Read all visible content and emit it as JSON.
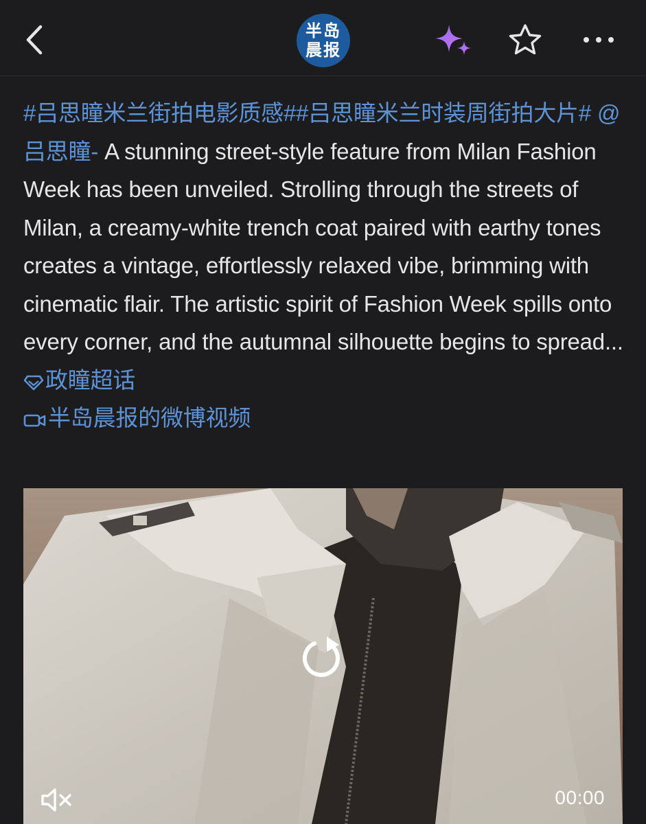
{
  "header": {
    "logo_text": "半岛晨报",
    "icons": {
      "back": "chevron-left-icon",
      "ai": "sparkle-icon",
      "favorite": "star-icon",
      "more": "more-dots-icon"
    },
    "accent_color": "#b06ef0"
  },
  "post": {
    "hashtag1": "#吕思瞳米兰街拍电影质感#",
    "hashtag2": "#吕思瞳米兰时装周街拍大片#",
    "mention": "@吕思瞳-",
    "body": " A stunning street-style feature from Milan Fashion Week has been unveiled. Strolling through the streets of Milan, a creamy-white trench coat paired with earthy tones creates a vintage, effortlessly relaxed vibe, brimming with cinematic flair. The artistic spirit of Fashion Week spills onto every corner, and the autumnal silhouette begins to spread... ",
    "topic_link": "政瞳超话",
    "video_link": "半岛晨报的微博视频",
    "link_color": "#5b93d6"
  },
  "video": {
    "time": "00:00",
    "icons": {
      "replay": "replay-icon",
      "mute": "muted-speaker-icon"
    }
  }
}
